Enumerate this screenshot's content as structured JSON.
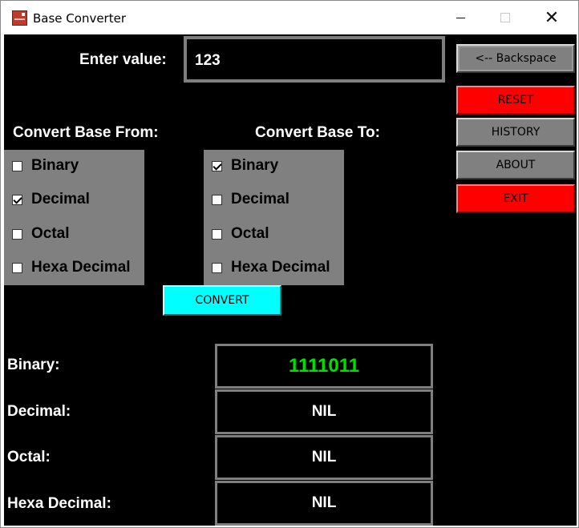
{
  "window": {
    "title": "Base Converter"
  },
  "input": {
    "label": "Enter value:",
    "value": "123"
  },
  "sidebar": {
    "backspace": "<-- Backspace",
    "reset": "RESET",
    "history": "HISTORY",
    "about": "ABOUT",
    "exit": "EXIT"
  },
  "from_section": {
    "heading": "Convert Base From:",
    "options": [
      {
        "label": "Binary",
        "checked": false
      },
      {
        "label": "Decimal",
        "checked": true
      },
      {
        "label": "Octal",
        "checked": false
      },
      {
        "label": "Hexa Decimal",
        "checked": false
      }
    ]
  },
  "to_section": {
    "heading": "Convert Base To:",
    "options": [
      {
        "label": "Binary",
        "checked": true
      },
      {
        "label": "Decimal",
        "checked": false
      },
      {
        "label": "Octal",
        "checked": false
      },
      {
        "label": "Hexa Decimal",
        "checked": false
      }
    ]
  },
  "convert_label": "CONVERT",
  "results": [
    {
      "label": "Binary:",
      "value": "1111011"
    },
    {
      "label": "Decimal:",
      "value": "NIL"
    },
    {
      "label": "Octal:",
      "value": "NIL"
    },
    {
      "label": "Hexa Decimal:",
      "value": "NIL"
    }
  ],
  "colors": {
    "result_highlight": "#00e000",
    "danger": "#ff0000",
    "accent": "#00ffff",
    "panel": "#808080"
  }
}
